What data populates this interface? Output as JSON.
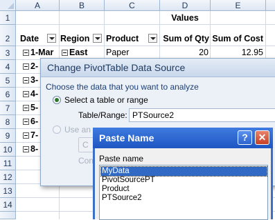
{
  "spreadsheet": {
    "columns": [
      "A",
      "B",
      "C",
      "D",
      "E"
    ],
    "rows": [
      "1",
      "2",
      "3",
      "4",
      "5",
      "6",
      "7",
      "8",
      "9",
      "10",
      "11",
      "12",
      "13",
      "14"
    ],
    "values_label": "Values",
    "headers": {
      "date": "Date",
      "region": "Region",
      "product": "Product",
      "sum_qty": "Sum of Qty",
      "sum_cost": "Sum of Cost"
    },
    "row3": {
      "date": "1-Mar",
      "region": "East",
      "product": "Paper",
      "qty": "20",
      "cost": "12.95"
    },
    "date_rows": [
      "2-",
      "3-",
      "4-",
      "5-",
      "6-",
      "7-",
      "8-"
    ]
  },
  "dialog_source": {
    "title": "Change PivotTable Data Source",
    "instruction": "Choose the data that you want to analyze",
    "option_range": "Select a table or range",
    "table_range_label": "Table/Range:",
    "table_range_value": "PTSource2",
    "option_external": "Use an e",
    "choose_button": "C",
    "connection_label": "Conn"
  },
  "dialog_paste": {
    "title": "Paste Name",
    "list_label": "Paste name",
    "names": [
      "MyData",
      "PivotSourcePT",
      "Product",
      "PTSource2"
    ],
    "selected": "MyData",
    "help_label": "?",
    "close_label": "✕"
  }
}
